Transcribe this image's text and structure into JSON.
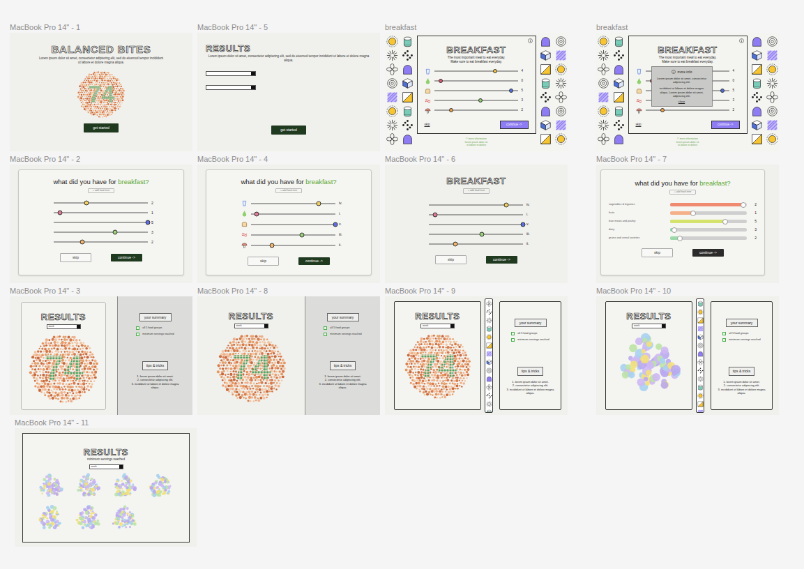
{
  "canvas": {
    "rows": [
      [
        {
          "label": "MacBook Pro 14\" - 1",
          "kind": "intro",
          "title": "BALANCED BITES",
          "text": "Lorem ipsum dolor sit amet, consectetur adipiscing elit, sed do eiusmod tempor incididunt ut labore et dolore magna aliqua.",
          "plate": "74",
          "button": "get started"
        },
        {
          "label": "MacBook Pro 14\" - 5",
          "kind": "results-start",
          "title": "RESULTS",
          "text": "Lorem ipsum dolor sit amet, consectetur adipiscing elit, sed do eiusmod tempor incididunt ut labore et dolore magna aliqua.",
          "fields": [
            {
              "value": ""
            },
            {
              "value": ""
            }
          ],
          "button": "get started"
        },
        {
          "label": "breakfast",
          "kind": "breakfast",
          "title": "BREAKFAST",
          "subtitle": [
            "The most important meal to eat everyday.",
            "Make sure to eat breakfast everyday."
          ],
          "sliders": [
            {
              "value": "4",
              "level": 0.73,
              "color": "#f4c542"
            },
            {
              "value": "0",
              "level": 0.08,
              "color": "#e05a6d"
            },
            {
              "value": "5",
              "level": 0.92,
              "color": "#4f6fe0"
            },
            {
              "value": "3",
              "level": 0.55,
              "color": "#8fd16a"
            },
            {
              "value": "2",
              "level": 0.2,
              "color": "#f0a24c"
            }
          ],
          "skip": "skip",
          "continue": "continue ->",
          "footer": [
            "© more information",
            "lorem ipsum dolor sit",
            "ut labore et dolore"
          ]
        },
        {
          "label": "breakfast",
          "kind": "breakfast",
          "title": "BREAKFAST",
          "subtitle": [
            "The most important meal to eat everyday.",
            "Make sure to eat breakfast everyday."
          ],
          "sliders": [
            {
              "value": "4",
              "level": 0.73,
              "color": "#f4c542"
            },
            {
              "value": "0",
              "level": 0.08,
              "color": "#e05a6d"
            },
            {
              "value": "5",
              "level": 0.92,
              "color": "#4f6fe0"
            },
            {
              "value": "3",
              "level": 0.55,
              "color": "#8fd16a"
            },
            {
              "value": "2",
              "level": 0.2,
              "color": "#f0a24c"
            }
          ],
          "skip": "skip",
          "continue": "continue ->",
          "footer": [
            "© more information",
            "lorem ipsum dolor sit",
            "ut labore et dolore"
          ],
          "modal": {
            "title": "more info",
            "body": [
              "Lorem ipsum dolor sit amet, consectetur adipiscing elit.",
              "incididunt ut labore et dolore magna aliqua. Lorem ipsum dolor sit amet, adipiscing elit."
            ],
            "close": "close"
          }
        }
      ],
      [
        {
          "label": "MacBook Pro 14\" - 2",
          "kind": "sliders",
          "heading": "what did you have for",
          "accent": "breakfast?",
          "pill": "+ add food item",
          "sliders": [
            {
              "value": "2",
              "level": 0.35,
              "color": "#f2cf5b"
            },
            {
              "value": "1",
              "level": 0.07,
              "color": "#e07a94"
            },
            {
              "value": "5",
              "level": 1,
              "color": "#5b6ee1"
            },
            {
              "value": "3",
              "level": 0.65,
              "color": "#9bd47a"
            },
            {
              "value": "2",
              "level": 0.3,
              "color": "#f2b56b"
            }
          ],
          "skip": "skip",
          "continue": "continue ->"
        },
        {
          "label": "MacBook Pro 14\" - 4",
          "kind": "sliders-icons",
          "heading": "what did you have for",
          "accent": "breakfast?",
          "pill": "+ add food item",
          "sliders": [
            {
              "value": "iv.",
              "level": 0.8,
              "color": "#f2cf5b"
            },
            {
              "value": "i.",
              "level": 0.07,
              "color": "#e07a94"
            },
            {
              "value": "v.",
              "level": 1,
              "color": "#5b6ee1"
            },
            {
              "value": "iii.",
              "level": 0.6,
              "color": "#9bd47a"
            },
            {
              "value": "ii.",
              "level": 0.25,
              "color": "#f2b56b"
            }
          ],
          "skip": "skip",
          "continue": "continue ->"
        },
        {
          "label": "MacBook Pro 14\" - 6",
          "kind": "sliders-title",
          "title": "BREAKFAST",
          "pill": "+ add food item",
          "sliders": [
            {
              "value": "iv.",
              "level": 0.82,
              "color": "#f2cf5b"
            },
            {
              "value": "i.",
              "level": 0.07,
              "color": "#e07a94"
            },
            {
              "value": "v.",
              "level": 1,
              "color": "#5b6ee1"
            },
            {
              "value": "iii.",
              "level": 0.56,
              "color": "#9bd47a"
            },
            {
              "value": "ii.",
              "level": 0.28,
              "color": "#f2b56b"
            }
          ],
          "skip": "skip",
          "continue": "continue ->"
        },
        {
          "label": "MacBook Pro 14\" - 7",
          "kind": "sliders-labeled",
          "heading": "what did you have for",
          "accent": "breakfast?",
          "pill": "+ add food item",
          "sliders": [
            {
              "label": "vegetables & legumes",
              "value": "2",
              "level": 0.95,
              "color": "#f08a70"
            },
            {
              "label": "fruits",
              "value": "1",
              "level": 0.3,
              "color": "#f5b08a"
            },
            {
              "label": "lean meats and poultry",
              "value": "5",
              "level": 0.72,
              "color": "#d5e26b"
            },
            {
              "label": "dairy",
              "value": "3",
              "level": 0.05,
              "color": "#86dcaa"
            },
            {
              "label": "grains and cereal varieties",
              "value": "2",
              "level": 0.13,
              "color": "#9ad9a8"
            }
          ],
          "skip": "skip",
          "continue": "continue ->"
        }
      ],
      [
        {
          "label": "MacBook Pro 14\" - 3",
          "kind": "results-card",
          "title": "RESULTS",
          "dropdown": "week",
          "plate": "74",
          "summary": {
            "title": "your summary",
            "checks": [
              {
                "label": "all 5 food groups",
                "checked": false
              },
              {
                "label": "minimum servings reached",
                "checked": false
              }
            ]
          },
          "tips": {
            "title": "tips & tricks",
            "items": [
              "1. lorem ipsum dolor sit amet.",
              "2. consectetur adipiscing elit.",
              "3. incididunt ut labore et dolore magna aliqua."
            ]
          }
        },
        {
          "label": "MacBook Pro 14\" - 8",
          "kind": "results-flat",
          "title": "RESULTS",
          "dropdown": "week",
          "plate": "74",
          "summary": {
            "title": "your summary",
            "checks": [
              {
                "label": "all 5 food groups",
                "checked": false
              },
              {
                "label": "minimum servings reached",
                "checked": false
              }
            ]
          },
          "tips": {
            "title": "tips & tricks",
            "items": [
              "1. lorem ipsum dolor sit amet.",
              "2. consectetur adipiscing elit.",
              "3. incididunt ut labore et dolore magna aliqua."
            ]
          }
        },
        {
          "label": "MacBook Pro 14\" - 9",
          "kind": "results-pattern",
          "title": "RESULTS",
          "dropdown": "week",
          "plate": "74",
          "summary": {
            "title": "your summary",
            "checks": [
              {
                "label": "all 5 food groups",
                "checked": false
              },
              {
                "label": "minimum servings reached",
                "checked": false
              }
            ]
          },
          "tips": {
            "title": "tips & tricks",
            "items": [
              "1. lorem ipsum dolor sit amet.",
              "2. consectetur adipiscing elit.",
              "3. incididunt ut labore et dolore magna aliqua."
            ]
          }
        },
        {
          "label": "MacBook Pro 14\" - 10",
          "kind": "results-pattern",
          "title": "RESULTS",
          "dropdown": "week",
          "summary": {
            "title": "your summary",
            "checks": [
              {
                "label": "all 5 food groups",
                "checked": false
              },
              {
                "label": "minimum servings reached",
                "checked": false
              }
            ]
          },
          "tips": {
            "title": "tips & tricks",
            "items": [
              "1. lorem ipsum dolor sit amet.",
              "2. consectetur adipiscing elit.",
              "3. incididunt ut labore et dolore magna aliqua."
            ]
          }
        }
      ],
      [
        {
          "label": "MacBook Pro 14\" - 11",
          "kind": "results-grid",
          "title": "RESULTS",
          "subtitle": "minimum servings reached",
          "dropdown": "week",
          "cluster_count": 7
        }
      ]
    ]
  }
}
